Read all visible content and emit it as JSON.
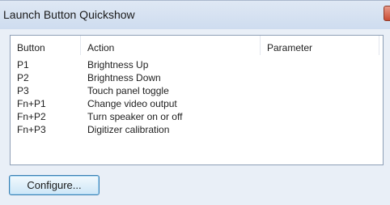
{
  "window": {
    "title": "Launch Button Quickshow",
    "close_glyph": "x"
  },
  "table": {
    "columns": [
      "Button",
      "Action",
      "Parameter"
    ],
    "rows": [
      {
        "button": "P1",
        "action": "Brightness Up",
        "parameter": ""
      },
      {
        "button": "P2",
        "action": "Brightness Down",
        "parameter": ""
      },
      {
        "button": "P3",
        "action": "Touch panel toggle",
        "parameter": ""
      },
      {
        "button": "Fn+P1",
        "action": "Change video output",
        "parameter": ""
      },
      {
        "button": "Fn+P2",
        "action": "Turn speaker on or off",
        "parameter": ""
      },
      {
        "button": "Fn+P3",
        "action": "Digitizer calibration",
        "parameter": ""
      }
    ]
  },
  "footer": {
    "configure_label": "Configure..."
  },
  "colors": {
    "titlebar": "#d6e2f2",
    "client_bg": "#e9eff7",
    "close_button": "#c94c33",
    "button_border": "#3c7fb1"
  }
}
